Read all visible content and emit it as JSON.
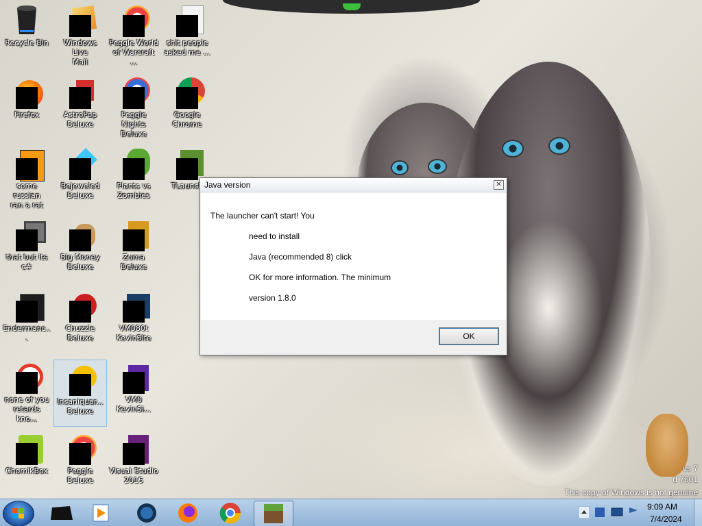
{
  "desktop": {
    "icons": [
      {
        "label": "Recycle Bin",
        "name": "recycle-bin-icon"
      },
      {
        "label": "Windows Live\nMail",
        "name": "windows-live-mail-icon"
      },
      {
        "label": "Peggle World\nof Warcraft ...",
        "name": "peggle-world-of-warcraft-icon"
      },
      {
        "label": "shit people\nasked me ...",
        "name": "shit-people-asked-me-icon"
      },
      {
        "label": "Firefox",
        "name": "firefox-icon"
      },
      {
        "label": "AstroPop\nDeluxe",
        "name": "astropop-deluxe-icon"
      },
      {
        "label": "Peggle Nights\nDeluxe",
        "name": "peggle-nights-deluxe-icon"
      },
      {
        "label": "Google\nChrome",
        "name": "google-chrome-icon"
      },
      {
        "label": "some russian\nran a rat",
        "name": "some-russian-ran-a-rat-icon"
      },
      {
        "label": "Bejeweled\nDeluxe",
        "name": "bejeweled-deluxe-icon"
      },
      {
        "label": "Plants vs\nZombies",
        "name": "plants-vs-zombies-icon"
      },
      {
        "label": "TLaunch",
        "name": "tlauncher-icon"
      },
      {
        "label": "that but its c#",
        "name": "that-but-its-csharp-icon"
      },
      {
        "label": "Big Money\nDeluxe",
        "name": "big-money-deluxe-icon"
      },
      {
        "label": "Zuma Deluxe",
        "name": "zuma-deluxe-icon"
      },
      {
        "label": "Endermanc...",
        "name": "endermanc-icon"
      },
      {
        "label": "Chuzzle\nDeluxe",
        "name": "chuzzle-deluxe-icon"
      },
      {
        "label": "VM080t\nKevinSite",
        "name": "vm080t-kevinsite-icon"
      },
      {
        "label": "none of you\nretards kno...",
        "name": "none-of-you-icon"
      },
      {
        "label": "Insaniquar...\nDeluxe",
        "name": "insaniquarium-deluxe-icon"
      },
      {
        "label": "VM0\nKevinSi...",
        "name": "vm0-kevinsite-icon"
      },
      {
        "label": "ChomikBox",
        "name": "chomikbox-icon"
      },
      {
        "label": "Peggle Deluxe",
        "name": "peggle-deluxe-icon"
      },
      {
        "label": "Visual Studio\n2015",
        "name": "visual-studio-2015-icon"
      }
    ]
  },
  "dialog": {
    "title": "Java version",
    "close_glyph": "✕",
    "message_lines": [
      "The launcher can't start! You",
      "need to install",
      "Java (recommended 8) click",
      "OK for more information. The minimum",
      "version 1.8.0"
    ],
    "ok_label": "OK"
  },
  "watermark": {
    "line1": "vs 7",
    "line2": "d 7601",
    "main": "This copy of Windows is not genuine"
  },
  "taskbar": {
    "items": [
      "start-button",
      "black-app-icon",
      "media-player-icon",
      "network-globe-icon",
      "firefox-taskbar-icon",
      "chrome-taskbar-icon",
      "minecraft-taskbar-icon"
    ],
    "clock_time": "9:09 AM",
    "clock_date": "7/4/2024"
  },
  "colors": {
    "taskbar": "#9fbfe0",
    "dialog_border": "#6c6c6c",
    "button_border": "#3c7fb1"
  }
}
